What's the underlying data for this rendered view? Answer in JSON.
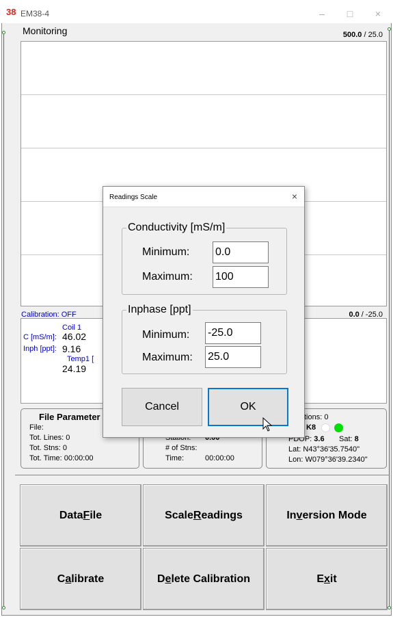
{
  "window": {
    "icon_text": "38",
    "title": "EM38-4",
    "minimize": "–",
    "maximize": "□",
    "close": "×"
  },
  "monitoring": {
    "label": "Monitoring",
    "scale_top_bold": "500.0",
    "scale_top_rest": " / 25.0",
    "calibration": "Calibration: OFF",
    "scale_bot_bold": "0.0",
    "scale_bot_rest": " / -25.0"
  },
  "readings": {
    "coil_label": "Coil 1",
    "c_label": "C [mS/m]:",
    "c_value": "46.02",
    "inph_label": "Inph [ppt]:",
    "inph_value": "9.16",
    "temp_label": "Temp1 [",
    "temp_value": "24.19"
  },
  "file_panel": {
    "title": "File Parameter",
    "file": "File:",
    "tot_lines": "Tot. Lines:  0",
    "tot_stns": "Tot. Stns:   0",
    "tot_time": "Tot. Time:  00:00:00"
  },
  "station_panel": {
    "station_label": "Station:",
    "station_value": "0.00",
    "num_stns": "# of Stns:",
    "time_label": "Time:",
    "time_value": "00:00:00"
  },
  "gps_panel": {
    "positions": "tions: 0",
    "mode": "K8",
    "pdop_label": "PDOP: ",
    "pdop_value": "3.6",
    "sat_label": "Sat: ",
    "sat_value": "8",
    "lat": "Lat:  N43°36'35.7540\"",
    "lon": "Lon: W079°36'39.2340\"",
    "status_off_color": "#ffffff",
    "status_on_color": "#00e000"
  },
  "buttons": {
    "data_file": {
      "pre": "Data ",
      "u": "F",
      "post": "ile"
    },
    "scale_readings": {
      "pre": "Scale ",
      "u": "R",
      "post": "eadings"
    },
    "inversion_mode": {
      "pre": "In",
      "u": "v",
      "post": "ersion Mode"
    },
    "calibrate": {
      "pre": "C",
      "u": "a",
      "post": "librate"
    },
    "delete_calibration": {
      "pre": "D",
      "u": "e",
      "post": "lete Calibration"
    },
    "exit": {
      "pre": "E",
      "u": "x",
      "post": "it"
    }
  },
  "dialog": {
    "title": "Readings Scale",
    "close": "×",
    "conductivity": {
      "legend": "Conductivity [mS/m]",
      "min_label": "Minimum:",
      "min_value": "0.0",
      "max_label": "Maximum:",
      "max_value": "100"
    },
    "inphase": {
      "legend": "Inphase [ppt]",
      "min_label": "Minimum:",
      "min_value": "-25.0",
      "max_label": "Maximum:",
      "max_value": "25.0"
    },
    "cancel_label": "Cancel",
    "ok_label": "OK"
  }
}
